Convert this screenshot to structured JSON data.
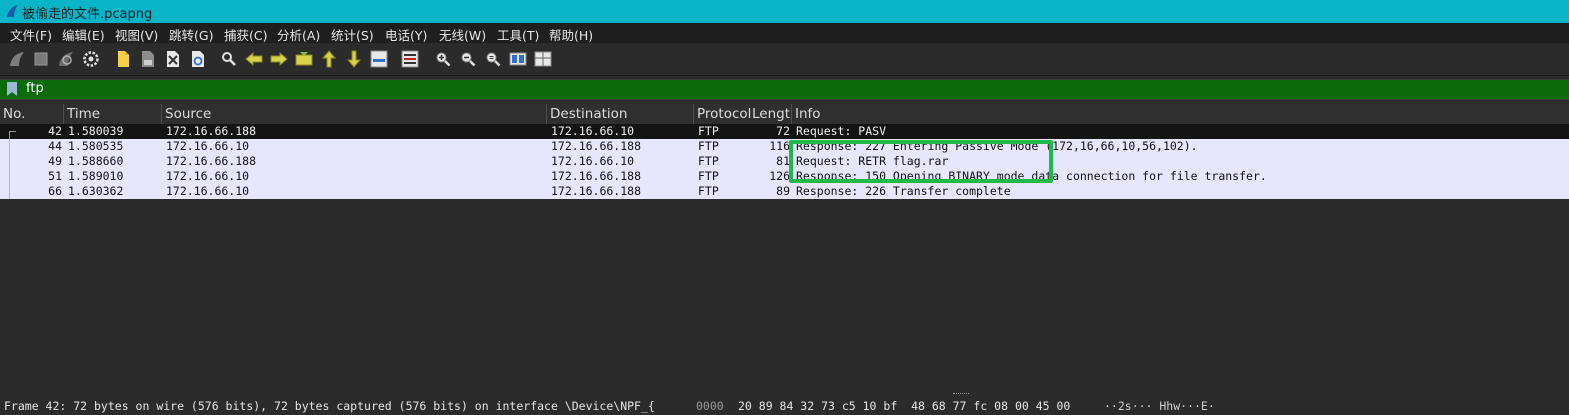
{
  "window": {
    "title": "被偷走的文件.pcapng"
  },
  "menu": [
    "文件(F)",
    "编辑(E)",
    "视图(V)",
    "跳转(G)",
    "捕获(C)",
    "分析(A)",
    "统计(S)",
    "电话(Y)",
    "无线(W)",
    "工具(T)",
    "帮助(H)"
  ],
  "filter": {
    "value": "ftp"
  },
  "columns": [
    "No.",
    "Time",
    "Source",
    "Destination",
    "Protocol",
    "Lengtl",
    "Info"
  ],
  "packets": [
    {
      "no": "42",
      "time": "1.580039",
      "source": "172.16.66.188",
      "destination": "172.16.66.10",
      "protocol": "FTP",
      "length": "72",
      "info": "Request: PASV"
    },
    {
      "no": "44",
      "time": "1.580535",
      "source": "172.16.66.10",
      "destination": "172.16.66.188",
      "protocol": "FTP",
      "length": "116",
      "info": "Response: 227 Entering Passive Mode (172,16,66,10,56,102)."
    },
    {
      "no": "49",
      "time": "1.588660",
      "source": "172.16.66.188",
      "destination": "172.16.66.10",
      "protocol": "FTP",
      "length": "81",
      "info": "Request: RETR flag.rar"
    },
    {
      "no": "51",
      "time": "1.589010",
      "source": "172.16.66.10",
      "destination": "172.16.66.188",
      "protocol": "FTP",
      "length": "126",
      "info": "Response: 150 Opening BINARY mode data connection for file transfer."
    },
    {
      "no": "66",
      "time": "1.630362",
      "source": "172.16.66.10",
      "destination": "172.16.66.188",
      "protocol": "FTP",
      "length": "89",
      "info": "Response: 226 Transfer complete"
    }
  ],
  "status": {
    "frame_info": "Frame 42: 72 bytes on wire (576 bits), 72 bytes captured (576 bits) on interface \\Device\\NPF_{",
    "hex_offset": "0000",
    "hex_bytes": "20 89 84 32 73 c5 10 bf  48 68 77 fc 08 00 45 00",
    "ascii": "··2s··· Hhw···E·"
  },
  "colors": {
    "titlebar": "#06b6c8",
    "filter_valid": "#0b6b0b",
    "row_normal": "#e7e6ff",
    "row_selected": "#141414",
    "highlight_box": "#1fb84a"
  },
  "toolbar_icons": [
    "shark-start-icon",
    "stop-icon",
    "restart-icon",
    "options-gear-icon",
    "open-file-icon",
    "save-file-icon",
    "close-file-icon",
    "reload-icon",
    "find-packet-icon",
    "go-back-icon",
    "go-forward-icon",
    "go-to-packet-icon",
    "first-packet-icon",
    "last-packet-icon",
    "autoscroll-icon",
    "colorize-icon",
    "zoom-in-icon",
    "zoom-out-icon",
    "normal-size-icon",
    "resize-columns-icon",
    "layout-icon"
  ]
}
